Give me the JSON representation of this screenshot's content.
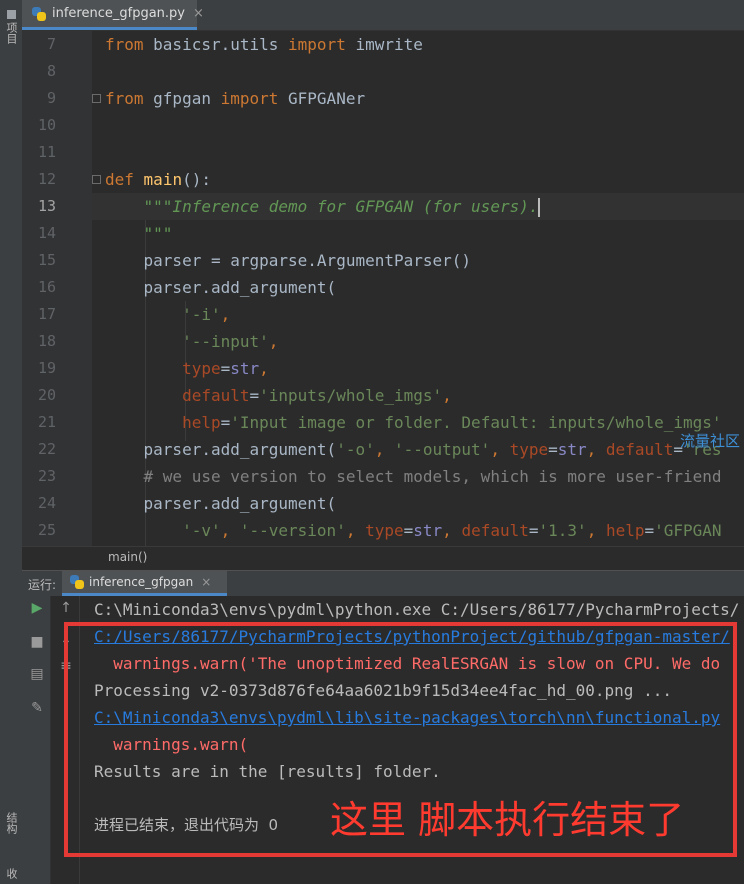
{
  "left_strip": {
    "project_label": "项目",
    "structure_label": "结构",
    "bottom_label": "收"
  },
  "editor_tab": {
    "filename": "inference_gfpgan.py",
    "close": "×"
  },
  "gutter": {
    "line_numbers": [
      "7",
      "8",
      "9",
      "10",
      "11",
      "12",
      "13",
      "14",
      "15",
      "16",
      "17",
      "18",
      "19",
      "20",
      "21",
      "22",
      "23",
      "24",
      "25"
    ],
    "current_line": "13"
  },
  "code": {
    "l7": [
      "from",
      " basicsr.utils ",
      "import",
      " imwrite"
    ],
    "l9": [
      "from",
      " gfpgan ",
      "import",
      " GFPGANer"
    ],
    "l12": [
      "def",
      " ",
      "main",
      "():"
    ],
    "l13": [
      "    ",
      "\"\"\"Inference demo for GFPGAN (for users)."
    ],
    "l14": [
      "    ",
      "\"\"\""
    ],
    "l15": "    parser = argparse.ArgumentParser()",
    "l16": "    parser.add_argument(",
    "l17": [
      "        ",
      "'-i'",
      ","
    ],
    "l18": [
      "        ",
      "'--input'",
      ","
    ],
    "l19": [
      "        ",
      "type",
      "=",
      "str",
      ","
    ],
    "l20": [
      "        ",
      "default",
      "=",
      "'inputs/whole_imgs'",
      ","
    ],
    "l21": [
      "        ",
      "help",
      "=",
      "'Input image or folder. Default: inputs/whole_imgs'"
    ],
    "l22": [
      "    parser.add_argument(",
      "'-o'",
      ", ",
      "'--output'",
      ", ",
      "type",
      "=",
      "str",
      ", ",
      "default",
      "=",
      "'res"
    ],
    "l23": [
      "    ",
      "# we use version to select models, which is more user-friend"
    ],
    "l24": "    parser.add_argument(",
    "l25": [
      "        ",
      "'-v'",
      ", ",
      "'--version'",
      ", ",
      "type",
      "=",
      "str",
      ", ",
      "default",
      "=",
      "'1.3'",
      ", ",
      "help",
      "=",
      "'GFPGAN"
    ]
  },
  "watermark": "流量社区",
  "breadcrumb": "main()",
  "run_panel": {
    "label": "运行:",
    "tab": "inference_gfpgan",
    "close": "×",
    "lines": [
      "C:\\Miniconda3\\envs\\pydml\\python.exe C:/Users/86177/PycharmProjects/",
      "C:/Users/86177/PycharmProjects/pythonProject/github/gfpgan-master/",
      "  warnings.warn('The unoptimized RealESRGAN is slow on CPU. We do",
      "Processing v2-0373d876fe64aa6021b9f15d34ee4fac_hd_00.png ...",
      "C:\\Miniconda3\\envs\\pydml\\lib\\site-packages\\torch\\nn\\functional.py",
      "  warnings.warn(",
      "Results are in the [results] folder.",
      "",
      "进程已结束，退出代码为  0"
    ]
  },
  "annotation": "这里 脚本执行结束了",
  "colors": {
    "keyword": "#cc7832",
    "string": "#6a8759",
    "function": "#ffc66d",
    "param": "#aa4926",
    "link": "#287bde",
    "error": "#ff6b68",
    "annotation": "#ff3b30"
  }
}
